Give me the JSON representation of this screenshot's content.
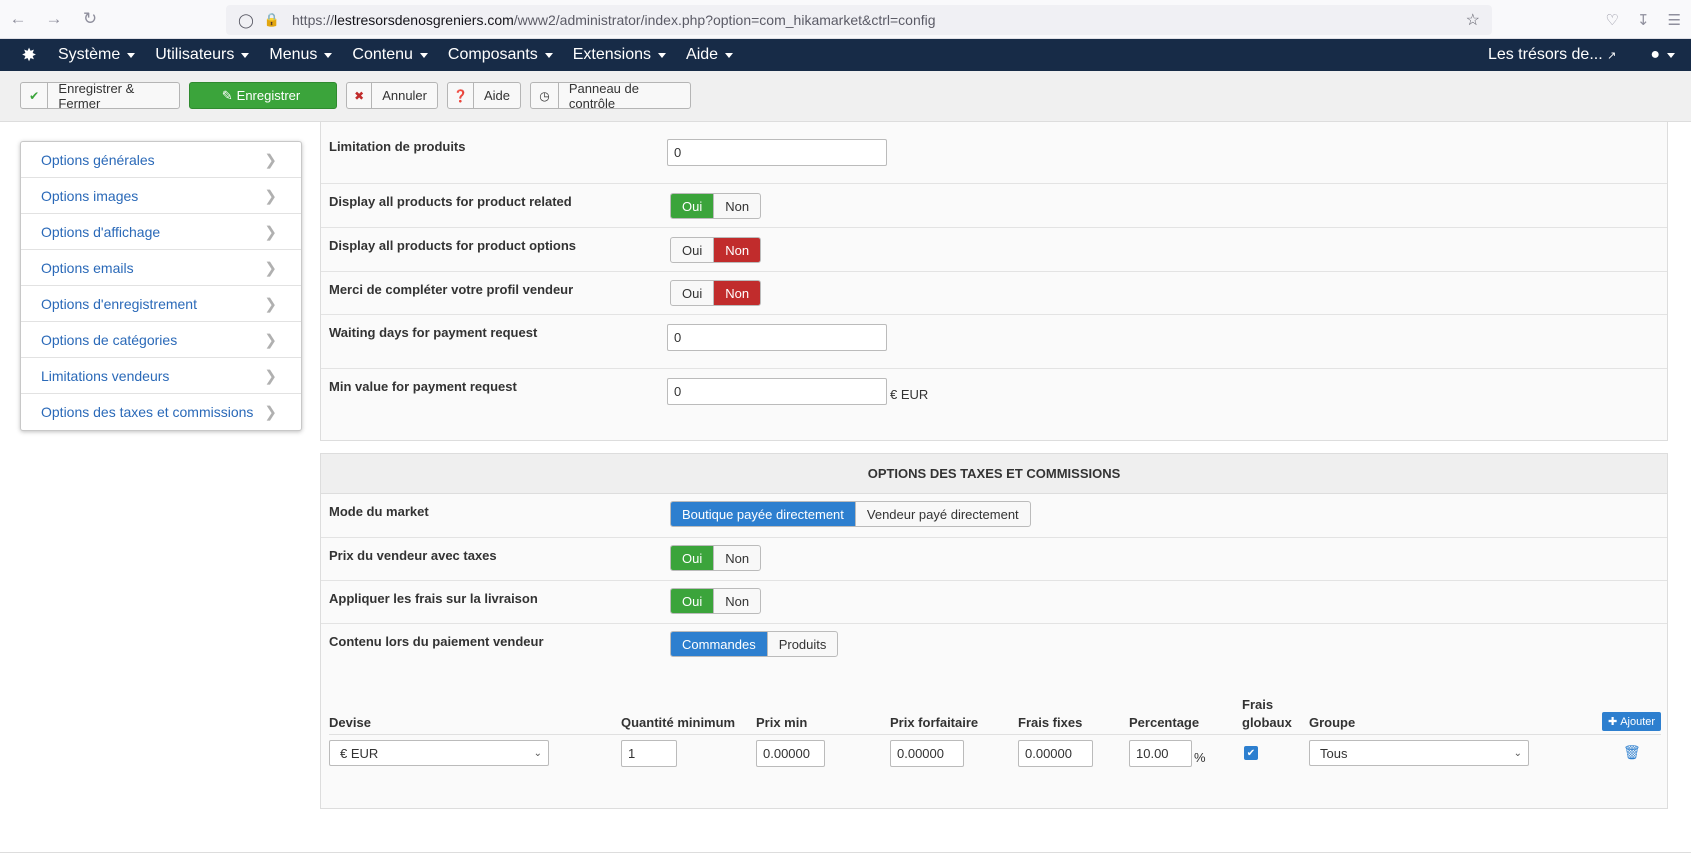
{
  "browser": {
    "url_prefix": "https://",
    "url_domain": "lestresorsdenosgreniers.com",
    "url_path": "/www2/administrator/index.php?option=com_hikamarket&ctrl=config"
  },
  "admin_nav": {
    "menus": [
      "Système",
      "Utilisateurs",
      "Menus",
      "Contenu",
      "Composants",
      "Extensions",
      "Aide"
    ],
    "site_link": "Les trésors de..."
  },
  "toolbar": {
    "save_close": "Enregistrer & Fermer",
    "save": "Enregistrer",
    "cancel": "Annuler",
    "help": "Aide",
    "control_panel": "Panneau de contrôle"
  },
  "sidebar": {
    "items": [
      "Options générales",
      "Options images",
      "Options d'affichage",
      "Options emails",
      "Options d'enregistrement",
      "Options de catégories",
      "Limitations vendeurs",
      "Options des taxes et commissions"
    ]
  },
  "limits": {
    "product_limit": {
      "label": "Limitation de produits",
      "value": "0"
    },
    "related": {
      "label": "Display all products for product related",
      "yes": "Oui",
      "no": "Non",
      "selected": "Oui"
    },
    "options": {
      "label": "Display all products for product options",
      "yes": "Oui",
      "no": "Non",
      "selected": "Non"
    },
    "profile": {
      "label": "Merci de compléter votre profil vendeur",
      "yes": "Oui",
      "no": "Non",
      "selected": "Non"
    },
    "waiting_days": {
      "label": "Waiting days for payment request",
      "value": "0"
    },
    "min_value": {
      "label": "Min value for payment request",
      "value": "0",
      "unit": "€ EUR"
    }
  },
  "taxes": {
    "title": "OPTIONS DES TAXES ET COMMISSIONS",
    "market_mode": {
      "label": "Mode du market",
      "opt1": "Boutique payée directement",
      "opt2": "Vendeur payé directement",
      "selected": "Boutique payée directement"
    },
    "vendor_price": {
      "label": "Prix du vendeur avec taxes",
      "yes": "Oui",
      "no": "Non",
      "selected": "Oui"
    },
    "shipping_fees": {
      "label": "Appliquer les frais sur la livraison",
      "yes": "Oui",
      "no": "Non",
      "selected": "Oui"
    },
    "payment_content": {
      "label": "Contenu lors du paiement vendeur",
      "opt1": "Commandes",
      "opt2": "Produits",
      "selected": "Commandes"
    },
    "table": {
      "headers": {
        "currency": "Devise",
        "min_qty": "Quantité minimum",
        "min_price": "Prix min",
        "flat_price": "Prix forfaitaire",
        "fixed_fees": "Frais fixes",
        "percentage": "Percentage",
        "global_fees_1": "Frais",
        "global_fees_2": "globaux",
        "group": "Groupe"
      },
      "add_label": "Ajouter",
      "row": {
        "currency": "€ EUR",
        "min_qty": "1",
        "min_price": "0.00000",
        "flat_price": "0.00000",
        "fixed_fees": "0.00000",
        "percentage": "10.00",
        "percent_sign": "%",
        "global_fees": true,
        "group": "Tous"
      }
    }
  },
  "colors": {
    "admin_nav": "#172b47",
    "green": "#3ba43b",
    "red": "#c12c2c",
    "blue": "#2d7fcf",
    "link": "#2a69b8"
  }
}
